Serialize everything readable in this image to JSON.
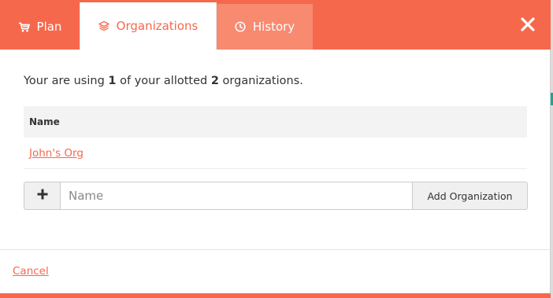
{
  "tabs": {
    "plan": {
      "label": "Plan",
      "icon": "cart-icon"
    },
    "organizations": {
      "label": "Organizations",
      "icon": "layers-icon"
    },
    "history": {
      "label": "History",
      "icon": "clock-icon"
    }
  },
  "close": {
    "icon": "close-icon"
  },
  "usage": {
    "prefix": "Your are using ",
    "used": "1",
    "middle": " of your allotted ",
    "allotted": "2",
    "suffix": " organizations."
  },
  "table": {
    "header": "Name",
    "rows": [
      {
        "name": "John's Org"
      }
    ]
  },
  "add_form": {
    "plus_icon": "plus-icon",
    "placeholder": "Name",
    "value": "",
    "button_label": "Add Organization"
  },
  "footer": {
    "cancel_label": "Cancel"
  },
  "colors": {
    "accent": "#f6684c",
    "tab_history": "#f88a70"
  }
}
